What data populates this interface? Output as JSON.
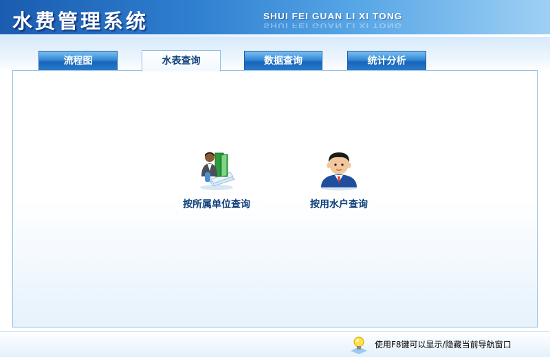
{
  "header": {
    "title": "水费管理系统",
    "subtitle": "SHUI FEI GUAN LI XI TONG"
  },
  "tabs": [
    {
      "label": "流程图",
      "active": false
    },
    {
      "label": "水表查询",
      "active": true
    },
    {
      "label": "数据查询",
      "active": false
    },
    {
      "label": "统计分析",
      "active": false
    }
  ],
  "options": [
    {
      "label": "按所属单位查询",
      "icon": "person-with-books-icon"
    },
    {
      "label": "按用水户查询",
      "icon": "user-avatar-icon"
    }
  ],
  "footer": {
    "hint": "使用F8键可以显示/隐藏当前导航窗口",
    "icon": "lightbulb-icon"
  },
  "colors": {
    "header_blue": "#1a5cb0",
    "tab_blue": "#2f86d6",
    "label_blue": "#0f3f7a",
    "panel_border": "#8bbde6"
  }
}
